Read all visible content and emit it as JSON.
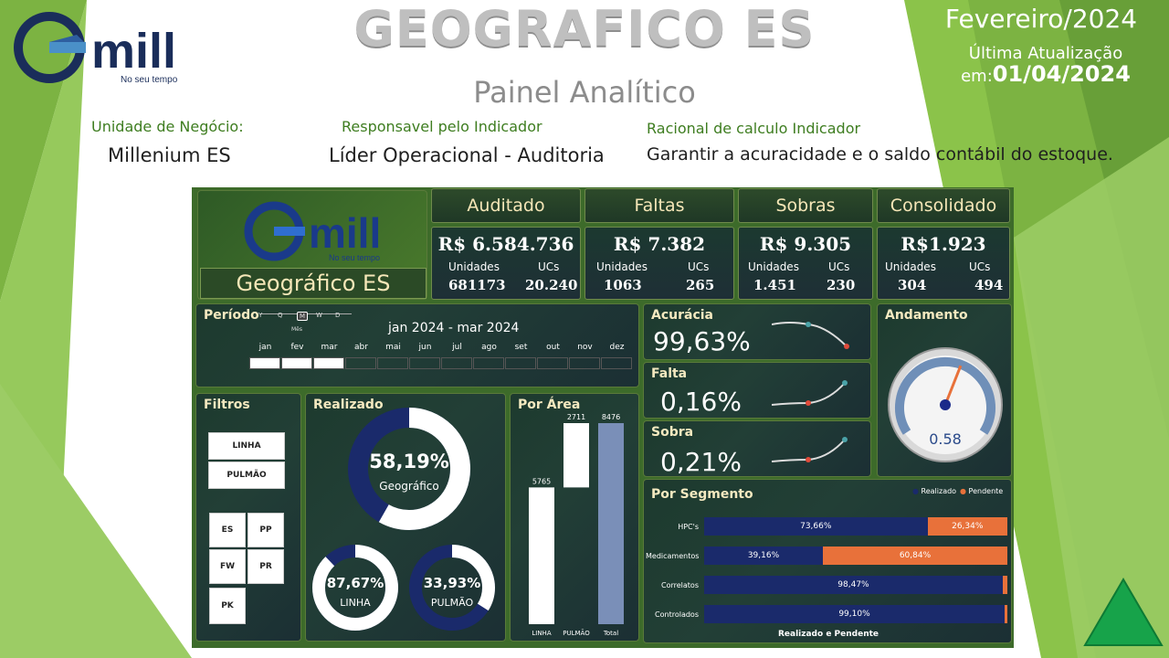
{
  "header": {
    "title": "GEOGRAFICO ES",
    "subtitle": "Painel Analítico",
    "month": "Fevereiro/2024",
    "update_label": "Última Atualização",
    "update_prefix": "em:",
    "update_date": "01/04/2024",
    "logo_text": "mill",
    "logo_tagline": "No seu tempo"
  },
  "info": {
    "business_unit_label": "Unidade de Negócio:",
    "business_unit_value": "Millenium ES",
    "owner_label": "Responsavel pelo Indicador",
    "owner_value": "Líder Operacional - Auditoria",
    "rationale_label": "Racional de calculo Indicador",
    "rationale_value": "Garantir a acuracidade e o saldo contábil do estoque."
  },
  "dashboard": {
    "brand_title": "Geográfico ES",
    "logo_text": "mill",
    "logo_tagline": "No seu tempo",
    "kpis": [
      {
        "title": "Auditado",
        "value": "R$ 6.584.736",
        "unit_label": "Unidades",
        "unit_value": "681173",
        "uc_label": "UCs",
        "uc_value": "20.240"
      },
      {
        "title": "Faltas",
        "value": "R$ 7.382",
        "unit_label": "Unidades",
        "unit_value": "1063",
        "uc_label": "UCs",
        "uc_value": "265"
      },
      {
        "title": "Sobras",
        "value": "R$ 9.305",
        "unit_label": "Unidades",
        "unit_value": "1.451",
        "uc_label": "UCs",
        "uc_value": "230"
      },
      {
        "title": "Consolidado",
        "value": "R$1.923",
        "unit_label": "Unidades",
        "unit_value": "304",
        "uc_label": "UCs",
        "uc_value": "494"
      }
    ],
    "period": {
      "title": "Período",
      "granularity": [
        "Y",
        "Q",
        "M",
        "W",
        "D"
      ],
      "granularity_selected_caption": "Mês",
      "range": "jan 2024 - mar 2024",
      "months": [
        "jan",
        "fev",
        "mar",
        "abr",
        "mai",
        "jun",
        "jul",
        "ago",
        "set",
        "out",
        "nov",
        "dez"
      ],
      "selected_count": 3
    },
    "acuracia": {
      "title": "Acurácia",
      "value": "99,63%"
    },
    "falta": {
      "title": "Falta",
      "value": "0,16%"
    },
    "sobra": {
      "title": "Sobra",
      "value": "0,21%"
    },
    "andamento": {
      "title": "Andamento",
      "value": "0.58",
      "fraction": 0.58
    },
    "filters": {
      "title": "Filtros",
      "area_buttons": [
        "LINHA",
        "PULMÃO"
      ],
      "segment_buttons": [
        "ES",
        "PP",
        "FW",
        "PR",
        "PK"
      ]
    },
    "realizado": {
      "title": "Realizado",
      "main": {
        "value": "58,19%",
        "label": "Geográfico",
        "fraction": 0.5819
      },
      "linha": {
        "value": "87,67%",
        "label": "LINHA",
        "fraction": 0.8767
      },
      "pulmao": {
        "value": "33,93%",
        "label": "PULMÃO",
        "fraction": 0.3393
      }
    },
    "por_area": {
      "title": "Por Área",
      "chart_data": {
        "type": "bar",
        "categories": [
          "LINHA",
          "PULMÃO",
          "Total"
        ],
        "values": [
          5765,
          2711,
          8476
        ],
        "value_labels": [
          "5765",
          "2711",
          "8476"
        ]
      }
    },
    "por_segmento": {
      "title": "Por Segmento",
      "legend": [
        {
          "name": "Realizado",
          "color": "#1a2a6b"
        },
        {
          "name": "Pendente",
          "color": "#e8713a"
        }
      ],
      "footer": "Realizado e Pendente",
      "chart_data": {
        "type": "bar",
        "categories": [
          "HPC's",
          "Medicamentos",
          "Correlatos",
          "Controlados"
        ],
        "series": [
          {
            "name": "Realizado",
            "values": [
              73.66,
              39.16,
              98.47,
              99.1
            ]
          },
          {
            "name": "Pendente",
            "values": [
              26.34,
              60.84,
              1.53,
              0.9
            ]
          }
        ],
        "realizado_labels": [
          "73,66%",
          "39,16%",
          "98,47%",
          "99,10%"
        ],
        "pendente_labels": [
          "26,34%",
          "60,84%",
          "",
          ""
        ]
      }
    }
  }
}
